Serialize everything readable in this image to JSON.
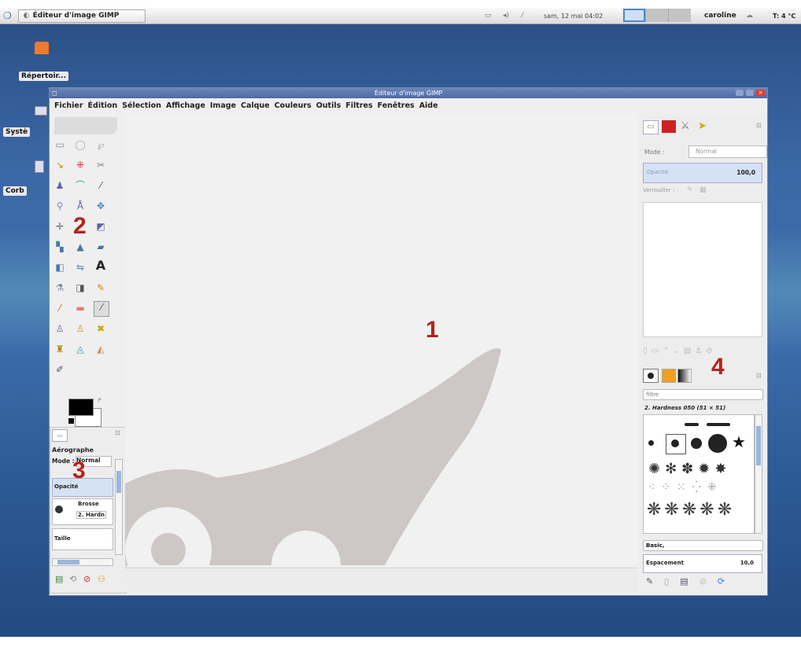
{
  "taskbar": {
    "app_button": "Éditeur d'image GIMP",
    "datetime": "sam, 12 mai 04:02",
    "user": "caroline",
    "temperature": "T: 4 °C"
  },
  "desktop": {
    "icons": [
      "Répertoir...",
      "Systè",
      "Corb"
    ]
  },
  "window": {
    "title": "Éditeur d'image GIMP",
    "menu": [
      "Fichier",
      "Édition",
      "Sélection",
      "Affichage",
      "Image",
      "Calque",
      "Couleurs",
      "Outils",
      "Filtres",
      "Fenêtres",
      "Aide"
    ]
  },
  "tool_options": {
    "tool_name": "Aérographe",
    "mode_label": "Mode :",
    "mode_value": "Normal",
    "opacity_label": "Opacité",
    "brush_label": "Brosse",
    "brush_value": "2. Hardn",
    "size_label": "Taille"
  },
  "layers_dock": {
    "mode_label": "Mode :",
    "mode_value": "Normal",
    "opacity_label": "Opacité",
    "opacity_value": "100,0",
    "lock_label": "Verrouiller :"
  },
  "brushes_dock": {
    "filter_placeholder": "filtre",
    "brush_title": "2. Hardness 050 (51 × 51)",
    "tag_value": "Basic,",
    "spacing_label": "Espacement",
    "spacing_value": "10,0"
  },
  "annotations": [
    "1",
    "2",
    "3",
    "4"
  ]
}
